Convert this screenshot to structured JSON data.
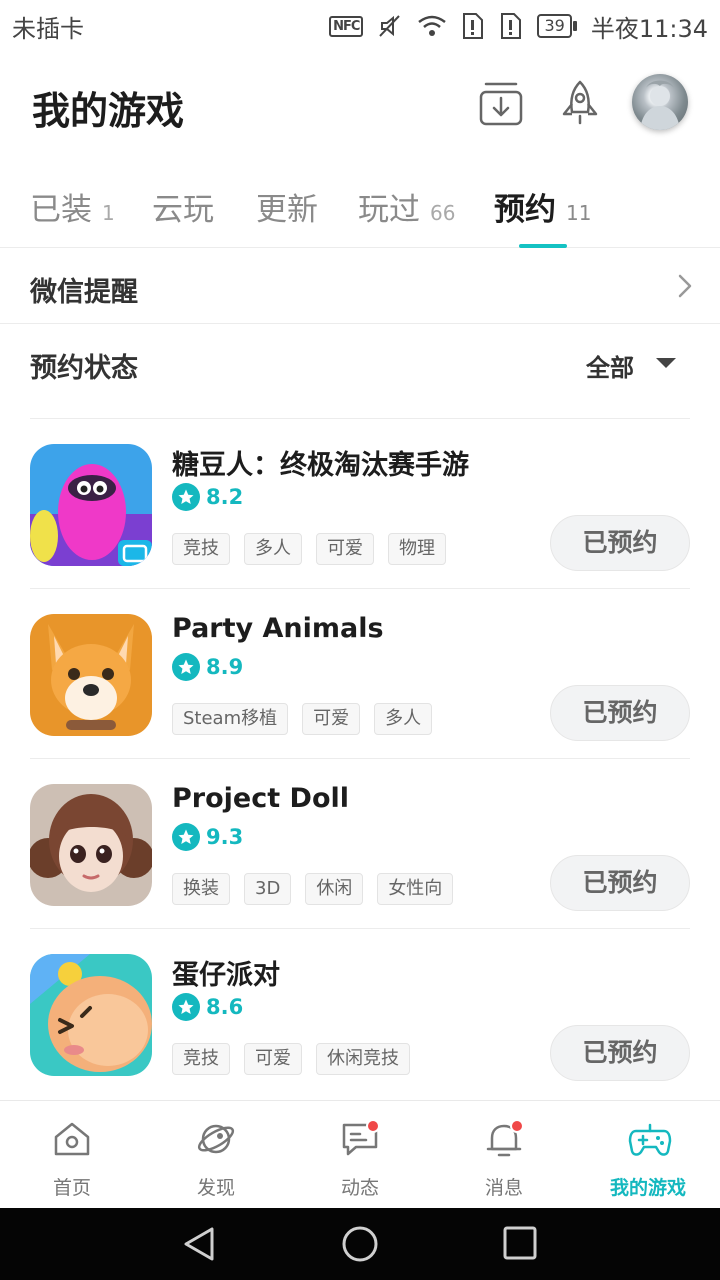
{
  "status_bar": {
    "carrier": "未插卡",
    "nfc": "NFC",
    "battery": "39",
    "time": "半夜11:34"
  },
  "header": {
    "title": "我的游戏",
    "icons": [
      "download-icon",
      "rocket-icon",
      "avatar"
    ]
  },
  "tabs": [
    {
      "label": "已装",
      "count": "1"
    },
    {
      "label": "云玩",
      "count": ""
    },
    {
      "label": "更新",
      "count": ""
    },
    {
      "label": "玩过",
      "count": "66"
    },
    {
      "label": "预约",
      "count": "11",
      "active": true
    }
  ],
  "wechat_row": {
    "label": "微信提醒"
  },
  "filter_row": {
    "label": "预约状态",
    "value": "全部"
  },
  "games": [
    {
      "name": "糖豆人：终极淘汰赛手游",
      "rating": "8.2",
      "tags": [
        "竞技",
        "多人",
        "可爱",
        "物理"
      ],
      "button": "已预约"
    },
    {
      "name": "Party Animals",
      "rating": "8.9",
      "tags": [
        "Steam移植",
        "可爱",
        "多人"
      ],
      "button": "已预约"
    },
    {
      "name": "Project Doll",
      "rating": "9.3",
      "tags": [
        "换装",
        "3D",
        "休闲",
        "女性向"
      ],
      "button": "已预约"
    },
    {
      "name": "蛋仔派对",
      "rating": "8.6",
      "tags": [
        "竞技",
        "可爱",
        "休闲竞技"
      ],
      "button": "已预约"
    }
  ],
  "bottom_nav": [
    {
      "label": "首页",
      "icon": "home-icon"
    },
    {
      "label": "发现",
      "icon": "planet-icon"
    },
    {
      "label": "动态",
      "icon": "chat-icon",
      "badge": true
    },
    {
      "label": "消息",
      "icon": "bell-icon",
      "badge": true
    },
    {
      "label": "我的游戏",
      "icon": "gamepad-icon",
      "active": true
    }
  ],
  "colors": {
    "accent": "#14b8bf",
    "badge": "#f04848",
    "text": "#1d1d1d"
  }
}
